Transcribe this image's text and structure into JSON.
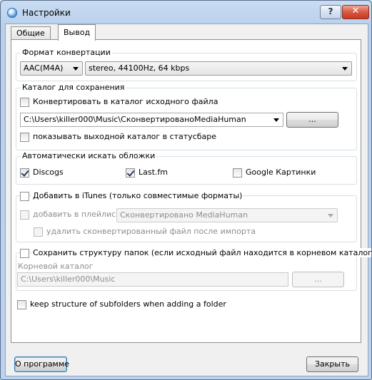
{
  "window": {
    "title": "Настройки",
    "help_label": "?",
    "close_label": "✕"
  },
  "tabs": [
    {
      "label": "Общие"
    },
    {
      "label": "Вывод"
    }
  ],
  "format_group": {
    "label": "Формат конвертации",
    "codec": "AAC(M4A)",
    "quality": "stereo, 44100Hz, 64 kbps"
  },
  "output_group": {
    "label": "Каталог для сохранения",
    "convert_to_source_label": "Конвертировать в каталог исходного файла",
    "convert_to_source_checked": false,
    "path": "C:\\Users\\killer000\\Music\\СконвертированоMediaHuman",
    "browse_label": "...",
    "show_in_statusbar_label": "показывать выходной каталог в статусбаре",
    "show_in_statusbar_checked": false
  },
  "covers_group": {
    "label": "Автоматически искать обложки",
    "items": [
      {
        "label": "Discogs",
        "checked": true
      },
      {
        "label": "Last.fm",
        "checked": true
      },
      {
        "label": "Google Картинки",
        "checked": false
      }
    ]
  },
  "itunes_group": {
    "add_label": "Добавить в iTunes (только совместимые форматы)",
    "add_checked": false,
    "playlist_label": "добавить в плейлист:",
    "playlist_value": "Сконвертировано MediaHuman",
    "delete_label": "удалить сконвертированный файл после импорта"
  },
  "structure_group": {
    "keep_label": "Сохранить структуру папок (если исходный файл находится в корневом каталоге)",
    "keep_checked": false,
    "root_label": "Корневой каталог",
    "root_value": "C:\\Users\\killer000\\Music",
    "browse_label": "..."
  },
  "subfolders_label": "keep structure of subfolders when adding a folder",
  "subfolders_checked": false,
  "footer": {
    "about_label": "О программе",
    "close_label": "Закрыть"
  }
}
